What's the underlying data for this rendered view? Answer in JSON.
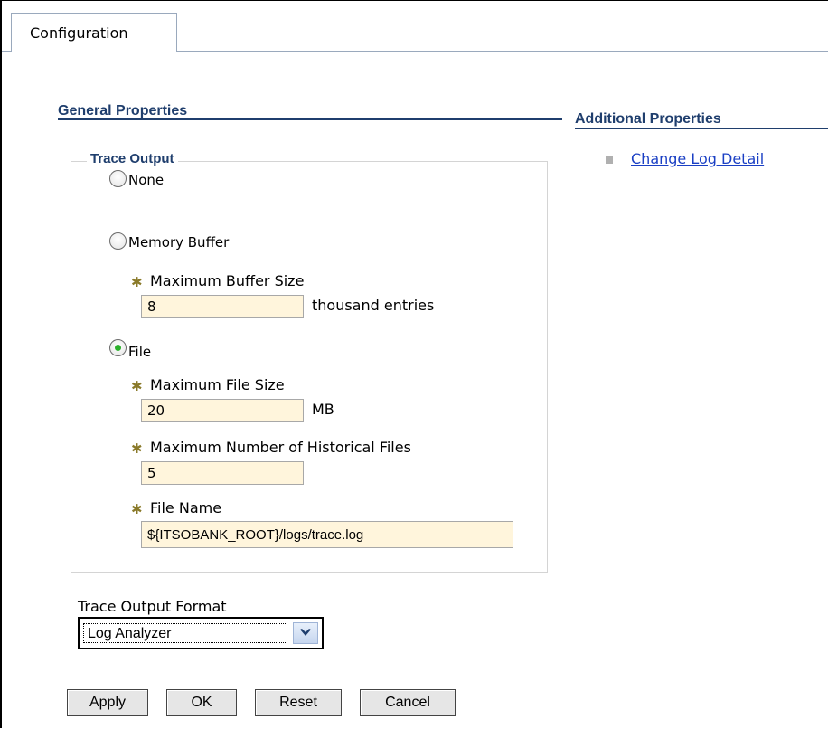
{
  "tabs": {
    "configuration": "Configuration"
  },
  "general_properties": {
    "title": "General Properties",
    "trace_output": {
      "legend": "Trace Output",
      "options": {
        "none": "None",
        "memory_buffer": "Memory Buffer",
        "file": "File"
      },
      "selected": "File",
      "max_buffer_size": {
        "label": "Maximum Buffer Size",
        "value": "8",
        "unit": "thousand entries"
      },
      "max_file_size": {
        "label": "Maximum File Size",
        "value": "20",
        "unit": "MB"
      },
      "max_historical_files": {
        "label": "Maximum Number of Historical Files",
        "value": "5"
      },
      "file_name": {
        "label": "File Name",
        "value": "${ITSOBANK_ROOT}/logs/trace.log"
      }
    },
    "trace_output_format": {
      "label": "Trace Output Format",
      "selected": "Log Analyzer"
    }
  },
  "additional_properties": {
    "title": "Additional Properties",
    "links": [
      "Change Log Detail"
    ]
  },
  "buttons": {
    "apply": "Apply",
    "ok": "OK",
    "reset": "Reset",
    "cancel": "Cancel"
  },
  "colors": {
    "heading": "#1f3e6d",
    "link": "#1a3fc4",
    "input_bg": "#fff5dc",
    "radio_checked": "#2bb02b"
  },
  "icons": {
    "dropdown": "chevron-down-icon",
    "bullet": "square-bullet-icon",
    "required": "asterisk-icon"
  }
}
